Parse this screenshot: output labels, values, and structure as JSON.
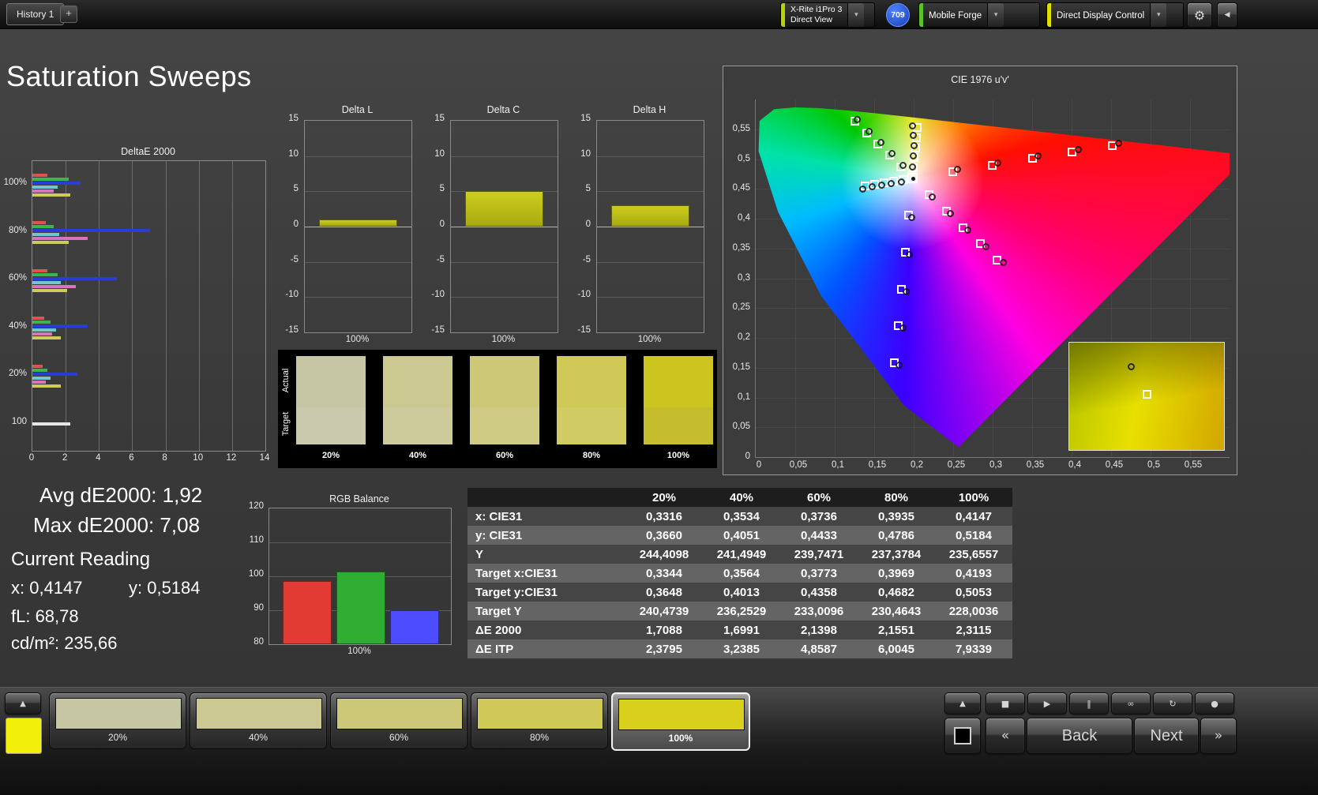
{
  "topbar": {
    "history_tab": "History 1",
    "add_tab": "+",
    "chevron_glyph": "▾",
    "gear_glyph": "⚙",
    "collapse_glyph": "◀",
    "meter": {
      "line1": "X-Rite i1Pro 3",
      "line2": "Direct View",
      "accent": "#b8d400"
    },
    "badge": "709",
    "pattern_source": {
      "label": "Mobile Forge",
      "accent": "#58c428"
    },
    "display_control": {
      "label": "Direct Display Control",
      "accent": "#e0e000"
    }
  },
  "page_title": "Saturation Sweeps",
  "stats": {
    "avg": "Avg dE2000: 1,92",
    "max": "Max dE2000: 7,08",
    "current_heading": "Current Reading",
    "x": "x: 0,4147",
    "y": "y: 0,5184",
    "fl": "fL: 68,78",
    "cd": "cd/m²: 235,66"
  },
  "swatch_strip": {
    "row_labels": [
      "Actual",
      "Target"
    ],
    "columns": [
      {
        "label": "20%",
        "actual": "#c7c6a4",
        "target": "#cac9ae"
      },
      {
        "label": "40%",
        "actual": "#cbc892",
        "target": "#cdca9c"
      },
      {
        "label": "60%",
        "actual": "#cdc877",
        "target": "#cfcb84"
      },
      {
        "label": "80%",
        "actual": "#cfc957",
        "target": "#d1cb64"
      },
      {
        "label": "100%",
        "actual": "#cdc51f",
        "target": "#c6bd2e"
      }
    ]
  },
  "chart_data": [
    {
      "name": "deltae2000",
      "type": "bar",
      "title": "DeltaE 2000",
      "orientation": "horizontal",
      "xlim": [
        0,
        14
      ],
      "xticks": [
        0,
        2,
        4,
        6,
        8,
        10,
        12,
        14
      ],
      "series_names": [
        "Red",
        "Green",
        "Blue",
        "Cyan",
        "Magenta",
        "Yellow"
      ],
      "bar_colors": [
        "#e0524a",
        "#3cb54a",
        "#2b3bd6",
        "#6fc8cc",
        "#d873c1",
        "#cfcb5a"
      ],
      "groups": [
        {
          "label": "100%",
          "values": [
            0.9,
            2.2,
            2.9,
            1.5,
            1.3,
            2.3
          ]
        },
        {
          "label": "80%",
          "values": [
            0.8,
            1.3,
            7.08,
            1.6,
            3.3,
            2.2
          ]
        },
        {
          "label": "60%",
          "values": [
            0.9,
            1.5,
            5.1,
            1.7,
            2.6,
            2.1
          ]
        },
        {
          "label": "40%",
          "values": [
            0.7,
            1.1,
            3.3,
            1.4,
            1.2,
            1.7
          ]
        },
        {
          "label": "20%",
          "values": [
            0.6,
            0.9,
            2.7,
            1.1,
            0.8,
            1.7
          ]
        },
        {
          "label": "100",
          "values": [
            2.3
          ],
          "color_override": "#e6e6e6"
        }
      ]
    },
    {
      "name": "delta_l",
      "type": "bar",
      "title": "Delta L",
      "ylim": [
        -15,
        15
      ],
      "yticks": [
        15,
        10,
        5,
        0,
        -5,
        -10,
        -15
      ],
      "categories": [
        "100%"
      ],
      "values": [
        1.0
      ],
      "bar_color": "#ccce1e"
    },
    {
      "name": "delta_c",
      "type": "bar",
      "title": "Delta C",
      "ylim": [
        -15,
        15
      ],
      "yticks": [
        15,
        10,
        5,
        0,
        -5,
        -10,
        -15
      ],
      "categories": [
        "100%"
      ],
      "values": [
        5.0
      ],
      "bar_color": "#ccce1e"
    },
    {
      "name": "delta_h",
      "type": "bar",
      "title": "Delta H",
      "ylim": [
        -15,
        15
      ],
      "yticks": [
        15,
        10,
        5,
        0,
        -5,
        -10,
        -15
      ],
      "categories": [
        "100%"
      ],
      "values": [
        3.0
      ],
      "bar_color": "#ccce1e"
    },
    {
      "name": "rgb_balance",
      "type": "bar",
      "title": "RGB Balance",
      "ylim": [
        80,
        120
      ],
      "yticks": [
        120,
        110,
        100,
        90,
        80
      ],
      "categories": [
        "100%"
      ],
      "series": [
        {
          "name": "Red",
          "color": "#e23b34",
          "value": 98.5
        },
        {
          "name": "Green",
          "color": "#2fae33",
          "value": 101.5
        },
        {
          "name": "Blue",
          "color": "#4d4dff",
          "value": 90
        }
      ]
    },
    {
      "name": "cie_1976",
      "type": "scatter",
      "title": "CIE 1976 u'v'",
      "xlim": [
        0,
        0.6
      ],
      "ylim": [
        0,
        0.6
      ],
      "tick_step": 0.05,
      "tick_labels": [
        "0",
        "0,05",
        "0,1",
        "0,15",
        "0,2",
        "0,25",
        "0,3",
        "0,35",
        "0,4",
        "0,45",
        "0,5",
        "0,55"
      ],
      "target_points": [
        [
          0.249,
          0.479
        ],
        [
          0.299,
          0.49
        ],
        [
          0.35,
          0.501
        ],
        [
          0.4,
          0.512
        ],
        [
          0.451,
          0.523
        ],
        [
          0.183,
          0.487
        ],
        [
          0.169,
          0.506
        ],
        [
          0.154,
          0.525
        ],
        [
          0.14,
          0.544
        ],
        [
          0.125,
          0.563
        ],
        [
          0.193,
          0.406
        ],
        [
          0.189,
          0.344
        ],
        [
          0.184,
          0.282
        ],
        [
          0.18,
          0.22
        ],
        [
          0.175,
          0.158
        ],
        [
          0.186,
          0.465
        ],
        [
          0.174,
          0.463
        ],
        [
          0.162,
          0.46
        ],
        [
          0.15,
          0.458
        ],
        [
          0.138,
          0.455
        ],
        [
          0.219,
          0.44
        ],
        [
          0.241,
          0.413
        ],
        [
          0.262,
          0.385
        ],
        [
          0.284,
          0.358
        ],
        [
          0.305,
          0.33
        ],
        [
          0.199,
          0.485
        ],
        [
          0.2,
          0.502
        ],
        [
          0.202,
          0.519
        ],
        [
          0.203,
          0.536
        ],
        [
          0.204,
          0.553
        ]
      ],
      "measured_points": [
        [
          0.255,
          0.483
        ],
        [
          0.306,
          0.494
        ],
        [
          0.357,
          0.505
        ],
        [
          0.408,
          0.516
        ],
        [
          0.459,
          0.527
        ],
        [
          0.186,
          0.49
        ],
        [
          0.172,
          0.509
        ],
        [
          0.158,
          0.528
        ],
        [
          0.143,
          0.547
        ],
        [
          0.128,
          0.566
        ],
        [
          0.197,
          0.402
        ],
        [
          0.194,
          0.34
        ],
        [
          0.19,
          0.278
        ],
        [
          0.186,
          0.216
        ],
        [
          0.181,
          0.154
        ],
        [
          0.184,
          0.462
        ],
        [
          0.171,
          0.459
        ],
        [
          0.159,
          0.456
        ],
        [
          0.147,
          0.453
        ],
        [
          0.135,
          0.45
        ],
        [
          0.223,
          0.436
        ],
        [
          0.246,
          0.409
        ],
        [
          0.268,
          0.381
        ],
        [
          0.291,
          0.353
        ],
        [
          0.313,
          0.326
        ],
        [
          0.198,
          0.487
        ],
        [
          0.199,
          0.505
        ],
        [
          0.2,
          0.523
        ],
        [
          0.199,
          0.54
        ],
        [
          0.198,
          0.556
        ]
      ],
      "white_point": [
        0.198,
        0.468
      ],
      "inset_markers": {
        "circle": [
          0.4,
          0.22
        ],
        "square": [
          0.5,
          0.48
        ]
      }
    },
    {
      "name": "measurement_table",
      "type": "table",
      "columns": [
        "",
        "20%",
        "40%",
        "60%",
        "80%",
        "100%"
      ],
      "rows": [
        [
          "x: CIE31",
          "0,3316",
          "0,3534",
          "0,3736",
          "0,3935",
          "0,4147"
        ],
        [
          "y: CIE31",
          "0,3660",
          "0,4051",
          "0,4433",
          "0,4786",
          "0,5184"
        ],
        [
          "Y",
          "244,4098",
          "241,4949",
          "239,7471",
          "237,3784",
          "235,6557"
        ],
        [
          "Target x:CIE31",
          "0,3344",
          "0,3564",
          "0,3773",
          "0,3969",
          "0,4193"
        ],
        [
          "Target y:CIE31",
          "0,3648",
          "0,4013",
          "0,4358",
          "0,4682",
          "0,5053"
        ],
        [
          "Target Y",
          "240,4739",
          "236,2529",
          "233,0096",
          "230,4643",
          "228,0036"
        ],
        [
          "ΔE 2000",
          "1,7088",
          "1,6991",
          "2,1398",
          "2,1551",
          "2,3115"
        ],
        [
          "ΔE ITP",
          "2,3795",
          "3,2385",
          "4,8587",
          "6,0045",
          "7,9339"
        ]
      ]
    }
  ],
  "bottombar": {
    "up_glyph": "▲",
    "current_color": "#f2ef0a",
    "swatches": [
      {
        "label": "20%",
        "color": "#c7c6a4",
        "selected": false
      },
      {
        "label": "40%",
        "color": "#cbc892",
        "selected": false
      },
      {
        "label": "60%",
        "color": "#cdc877",
        "selected": false
      },
      {
        "label": "80%",
        "color": "#cfc957",
        "selected": false
      },
      {
        "label": "100%",
        "color": "#d8d01c",
        "selected": true
      }
    ],
    "transport_icons": [
      {
        "name": "stop-icon",
        "glyph": "■"
      },
      {
        "name": "play-icon",
        "glyph": "▶"
      },
      {
        "name": "pause-icon",
        "glyph": "‖"
      },
      {
        "name": "continuous-icon",
        "glyph": "∞"
      },
      {
        "name": "refresh-icon",
        "glyph": "↻"
      },
      {
        "name": "record-icon",
        "glyph": "●"
      }
    ],
    "prev_glyph": "«",
    "back_label": "Back",
    "next_label": "Next",
    "next_glyph": "»"
  }
}
